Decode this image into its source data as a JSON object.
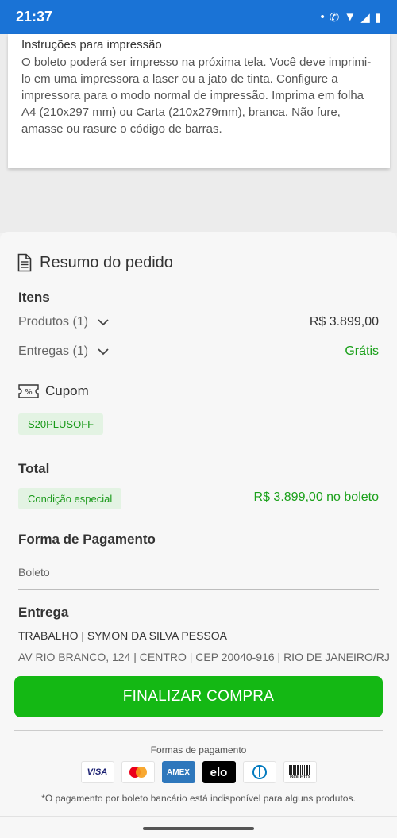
{
  "status": {
    "time": "21:37"
  },
  "instructions": {
    "title": "Instruções para impressão",
    "text": "O boleto poderá ser impresso na próxima tela. Você deve imprimi-lo em uma impressora a laser ou a jato de tinta. Configure a impressora para o modo normal de impressão. Imprima em folha A4 (210x297 mm) ou Carta (210x279mm), branca. Não fure, amasse ou rasure o código de barras."
  },
  "summary": {
    "title": "Resumo do pedido",
    "itens_title": "Itens",
    "produtos_label": "Produtos (1)",
    "produtos_value": "R$ 3.899,00",
    "entregas_label": "Entregas (1)",
    "entregas_value": "Grátis",
    "cupom_title": "Cupom",
    "cupom_code": "S20PLUSOFF",
    "total_title": "Total",
    "total_badge": "Condição especial",
    "total_value": "R$ 3.899,00 no boleto",
    "forma_title": "Forma de Pagamento",
    "forma_value": "Boleto",
    "entrega_title": "Entrega",
    "entrega_name": "TRABALHO | SYMON DA SILVA PESSOA",
    "entrega_address": "AV RIO BRANCO, 124 | CENTRO | CEP 20040-916 | RIO DE JANEIRO/RJ"
  },
  "actions": {
    "finalizar": "FINALIZAR COMPRA"
  },
  "payments": {
    "title": "Formas de pagamento",
    "methods": [
      {
        "name": "visa-icon",
        "label": "VISA"
      },
      {
        "name": "mastercard-icon",
        "label": ""
      },
      {
        "name": "amex-icon",
        "label": "AMEX"
      },
      {
        "name": "elo-icon",
        "label": "elo"
      },
      {
        "name": "diners-icon",
        "label": ""
      },
      {
        "name": "boleto-icon",
        "label": "BOLETO"
      }
    ],
    "note": "*O pagamento por boleto bancário está indisponível para alguns produtos."
  },
  "colors": {
    "status_bar": "#1a73d6",
    "accent_green": "#14b814",
    "price_green": "#1aa01a"
  }
}
